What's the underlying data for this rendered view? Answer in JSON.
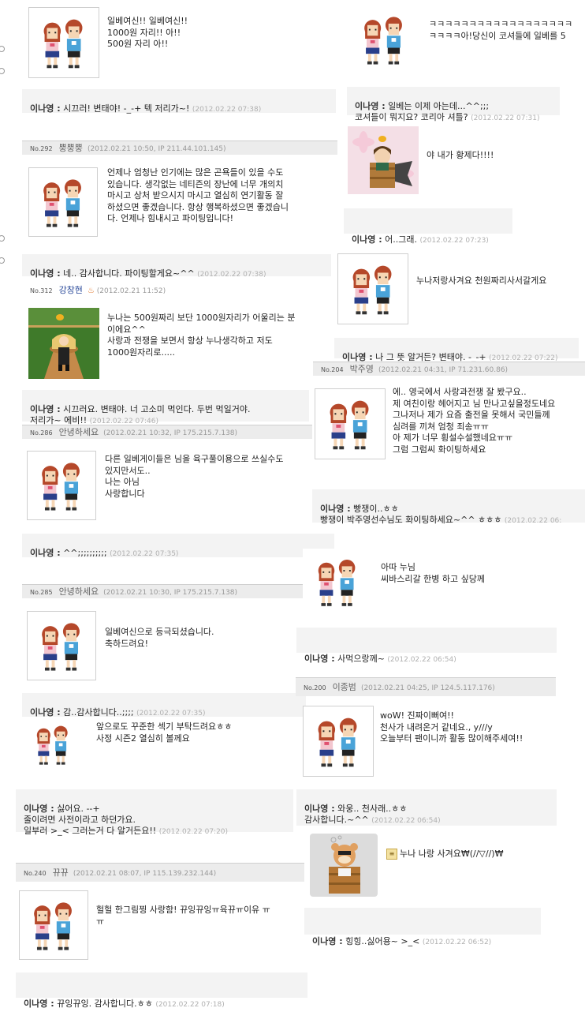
{
  "left": [
    {
      "comment": "일베여신!! 일베여신!!\n1000원 자리!! 아!!\n500원 자리 아!!",
      "reply_name": "이나영 :",
      "reply_text": "시끄러! 변태야! -_-+ 텍 저리가~!",
      "reply_time": "(2012.02.22 07:38)"
    },
    {
      "no": "No.292",
      "name": "뿡뿡뿡",
      "meta": "(2012.02.21 10:50, IP 211.44.101.145)",
      "comment": "언제나 엄청난 인기에는 많은 곤욕들이 있을 수도\n있습니다. 생각없는 네티즌의 장난에 너무 개의치\n마시고 상처 받으시지 마시고 열심히 연기활동 잘\n하셨으면 좋겠습니다. 항상 행복하셨으면 좋겠습니\n다. 언제나 힘내시고 파이팅입니다!",
      "reply_name": "이나영 :",
      "reply_text": "네.. 감사합니다. 파이팅할게요~^^",
      "reply_time": "(2012.02.22 07:38)"
    },
    {
      "no": "No.312",
      "name": "강창현",
      "meta": "(2012.02.21 11:52)",
      "comment": "누나는 500원짜리 보단 1000원자리가 어울리는 분\n이에요^^\n사랑과 전쟁을 보면서 항상 누나생각하고 저도\n1000원자리로.....",
      "reply_name": "이나영 :",
      "reply_text": "시끄러요. 변태야. 너 고소미 먹인다. 두번 먹일거야.\n저리가~ 에비!!",
      "reply_time": "(2012.02.22 07:46)"
    },
    {
      "no": "No.286",
      "name": "안녕하세요",
      "meta": "(2012.02.21 10:32, IP 175.215.7.138)",
      "comment": "다른 일베게이들은 님을 육구풀이용으로 쓰실수도\n있지만서도..\n나는 아님\n사랑합니다",
      "reply_name": "이나영 :",
      "reply_text": "^^;;;;;;;;;;",
      "reply_time": "(2012.02.22 07:35)"
    },
    {
      "no": "No.285",
      "name": "안녕하세요",
      "meta": "(2012.02.21 10:30, IP 175.215.7.138)",
      "comment": "일베여신으로 등극되셨습니다.\n축하드려요!",
      "reply_name": "이나영 :",
      "reply_text": "감..감사합니다..;;;;",
      "reply_time": "(2012.02.22 07:35)"
    },
    {
      "comment": "앞으로도 꾸준한 섹기 부탁드려요ㅎㅎ\n사정 시즌2 열심히 볼께요",
      "reply_name": "이나영 :",
      "reply_text": "싫어요. --+\n줄이려면 사전이라고 하던가요.\n일부러 >_< 그러는거 다 알거든요!!",
      "reply_time": "(2012.02.22 07:20)"
    },
    {
      "no": "No.240",
      "name": "뀨뀨",
      "meta": "(2012.02.21 08:07, IP 115.139.232.144)",
      "comment": "헐헐 한그림찡 사랑함! 뀨잉뀨잉ㅠ육뀨ㅠ이유 ㅠ\nㅠ",
      "reply_name": "이나영 :",
      "reply_text": "뀨잉뀨잉. 감사합니다.ㅎㅎ",
      "reply_time": "(2012.02.22 07:18)"
    }
  ],
  "right": [
    {
      "comment": "ㅋㅋㅋㅋㅋㅋㅋㅋㅋㅋㅋㅋㅋㅋㅋㅋㅋㅋ\nㅋㅋㅋㅋ아!당신이 코셔들에 일베를 5",
      "reply_name": "이나영 :",
      "reply_text": "일베는 이제 아는데...^^;;;\n코셔들이 뭐지요? 코리아 셔틀?",
      "reply_time": "(2012.02.22 07:31)"
    },
    {
      "comment": "야 내가 황제다!!!!",
      "reply_name": "이나영 :",
      "reply_text": "어..그래.",
      "reply_time": "(2012.02.22 07:23)"
    },
    {
      "comment": "누나저랑사겨요 천원짜리사서갈게요",
      "reply_name": "이나영 :",
      "reply_text": "나 그 뜻 알거든? 변태야. -_-+",
      "reply_time": "(2012.02.22 07:22)"
    },
    {
      "no": "No.204",
      "name": "박주영",
      "meta": "(2012.02.21 04:31, IP 71.231.60.86)",
      "comment": "에.. 영국에서 사랑과전쟁 잘 봤구요..\n제 여친이랑 헤어지고 님 만나고싶을정도네요\n그나저나 제가 요즘 출전을 못해서 국민들께\n심려를 끼쳐 엄청 죄송ㅠㅠ\n아 제가 너무 횡설수설했네요ㅠㅠ\n그럼 그럼씨 화이팅하세요",
      "reply_name": "이나영 :",
      "reply_text": "빵쟁이..ㅎㅎ\n빵쟁이 박주영선수님도 화이팅하세요~^^ ㅎㅎㅎ",
      "reply_time": "(2012.02.22 06:"
    },
    {
      "comment": "아따 누님\n씨바스리갈 한병 하고 싶당께",
      "reply_name": "이나영 :",
      "reply_text": "사먹으랑께~",
      "reply_time": "(2012.02.22 06:54)"
    },
    {
      "no": "No.200",
      "name": "이종범",
      "meta": "(2012.02.21 04:25, IP 124.5.117.176)",
      "comment": "woW! 진짜이뻐여!!\n천사가 내려온거 같네요., y///y\n오늘부터 팬이니까 활동 많이해주세여!!",
      "reply_name": "이나영 :",
      "reply_text": "와웅.. 천사래..ㅎㅎ\n감사합니다.~^^",
      "reply_time": "(2012.02.22 06:54)"
    },
    {
      "comment": "누나 나랑 사겨요₩(//▽//)₩",
      "reply_name": "이나영 :",
      "reply_text": "힝힝..싫어용~ >_<",
      "reply_time": "(2012.02.22 06:52)"
    }
  ]
}
